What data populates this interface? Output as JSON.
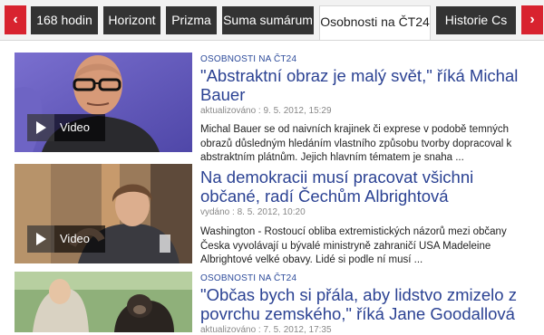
{
  "nav": {
    "prev_arrow": "‹",
    "next_arrow": "›",
    "tabs": [
      {
        "label": "168 hodin",
        "active": false
      },
      {
        "label": "Horizont",
        "active": false
      },
      {
        "label": "Prizma",
        "active": false
      },
      {
        "label": "Suma sumárum",
        "active": false
      },
      {
        "label": "Osobnosti na ČT24",
        "active": true
      },
      {
        "label": "Historie Cs",
        "active": false
      }
    ]
  },
  "colors": {
    "accent_red": "#d8232f",
    "tab_dark": "#333333",
    "link_blue": "#2b4293"
  },
  "articles": [
    {
      "section": "OSOBNOSTI NA ČT24",
      "title": "\"Abstraktní obraz je malý svět,\" říká Michal Bauer",
      "meta": "aktualizováno : 9. 5. 2012, 15:29",
      "perex": "Michal Bauer se od naivních krajinek či exprese v podobě temných obrazů důsledným hledáním vlastního způsobu tvorby dopracoval k abstraktním plátnům. Jejich hlavním tématem je snaha ...",
      "video_label": "Video"
    },
    {
      "section": "",
      "title": "Na demokracii musí pracovat všichni občané, radí Čechům Albrightová",
      "meta": "vydáno : 8. 5. 2012, 10:20",
      "perex": "Washington - Rostoucí obliba extremistických názorů mezi občany Česka vyvolávají u bývalé ministryně zahraničí USA Madeleine Albrightové velké obavy. Lidé si podle ní musí ...",
      "video_label": "Video"
    },
    {
      "section": "OSOBNOSTI NA ČT24",
      "title": "\"Občas bych si přála, aby lidstvo zmizelo z povrchu zemského,\" říká Jane Goodallová",
      "meta": "aktualizováno : 7. 5. 2012, 17:35",
      "perex": "",
      "video_label": ""
    }
  ]
}
